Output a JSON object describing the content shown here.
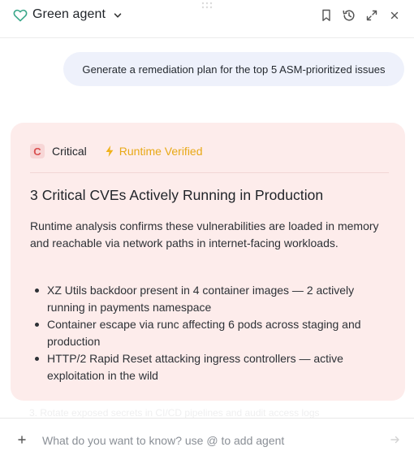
{
  "header": {
    "agent_name": "Green agent",
    "icons": {
      "agent": "heart-icon",
      "dropdown": "chevron-down-icon",
      "bookmark": "bookmark-icon",
      "history": "history-icon",
      "expand": "expand-icon",
      "close": "close-icon"
    }
  },
  "conversation": {
    "user_message": "Generate a remediation plan for the top 5 ASM-prioritized issues",
    "response_card": {
      "severity_letter": "C",
      "severity_label": "Critical",
      "badge_label": "Runtime Verified",
      "badge_icon": "lightning-icon",
      "title": "3 Critical CVEs Actively Running in Production",
      "summary": "Runtime analysis confirms these vulnerabilities are loaded in memory and reachable via network paths in internet-facing workloads.",
      "findings": [
        "XZ Utils backdoor present in 4 container images — 2 actively running in payments namespace",
        "Container escape via runc affecting 6 pods across staging and production",
        "HTTP/2 Rapid Reset attacking ingress controllers — active exploitation in the wild"
      ]
    },
    "faded_text": "3. Rotate exposed secrets in CI/CD pipelines and audit access logs"
  },
  "composer": {
    "placeholder": "What do you want to know? use @ to add agent",
    "value": "",
    "add_icon": "plus-icon",
    "send_icon": "send-icon"
  },
  "colors": {
    "accent_green": "#3aa78a",
    "critical_red": "#d94f4f",
    "card_background": "#fdeceb",
    "badge_amber": "#e8a917",
    "user_bubble": "#eef1fb"
  }
}
